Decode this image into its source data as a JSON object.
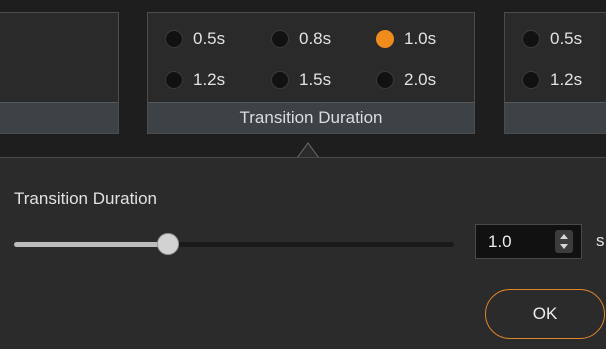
{
  "center_panel": {
    "options": [
      "0.5s",
      "0.8s",
      "1.0s",
      "1.2s",
      "1.5s",
      "2.0s"
    ],
    "selected": "1.0s",
    "footer_label": "Transition Duration"
  },
  "right_panel": {
    "options": [
      "0.5s",
      "1.2s"
    ]
  },
  "settings": {
    "label": "Transition Duration",
    "slider_value": 0.35,
    "value": "1.0",
    "unit": "s",
    "ok_label": "OK"
  },
  "colors": {
    "accent": "#f08c1e",
    "background": "#2b2b2b",
    "toolbar_background": "#1e1e1e"
  }
}
